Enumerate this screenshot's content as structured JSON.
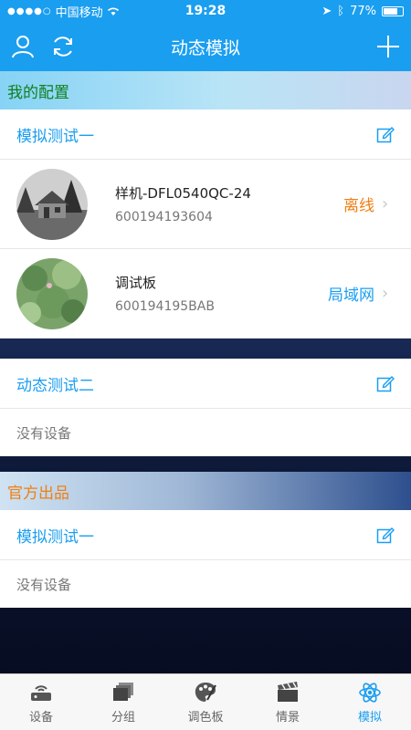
{
  "status_bar": {
    "carrier": "中国移动",
    "time": "19:28",
    "battery": "77%"
  },
  "header": {
    "title": "动态模拟"
  },
  "sections": [
    {
      "title": "我的配置",
      "groups": [
        {
          "name": "模拟测试一",
          "devices": [
            {
              "name": "样机-DFL0540QC-24",
              "id": "600194193604",
              "status": "离线"
            },
            {
              "name": "调试板",
              "id": "600194195BAB",
              "status": "局域网"
            }
          ]
        },
        {
          "name": "动态测试二",
          "empty_text": "没有设备"
        }
      ]
    },
    {
      "title": "官方出品",
      "groups": [
        {
          "name": "模拟测试一",
          "empty_text": "没有设备"
        }
      ]
    }
  ],
  "tabs": [
    {
      "label": "设备"
    },
    {
      "label": "分组"
    },
    {
      "label": "调色板"
    },
    {
      "label": "情景"
    },
    {
      "label": "模拟",
      "active": true
    }
  ],
  "colors": {
    "accent": "#1a9ef0",
    "offline": "#f07f13",
    "lan": "#1a9ef0",
    "section_green": "#0f7f1e"
  }
}
